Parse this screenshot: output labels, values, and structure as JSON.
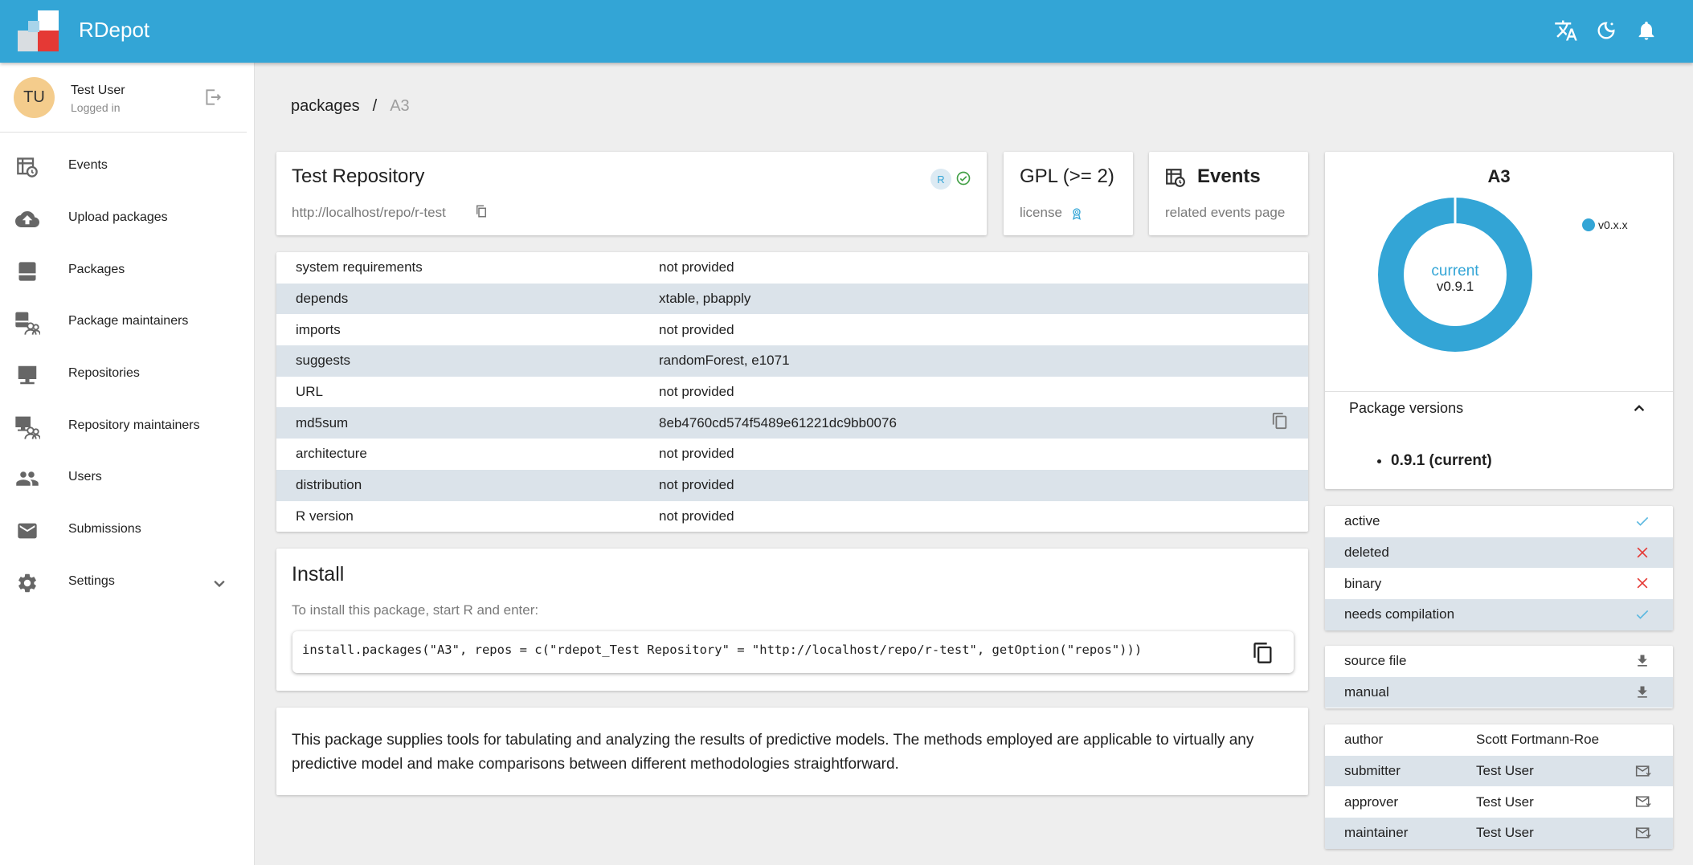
{
  "app": {
    "title": "RDepot"
  },
  "user": {
    "initials": "TU",
    "name": "Test User",
    "status": "Logged in"
  },
  "nav": [
    {
      "label": "Events",
      "icon": "events-icon"
    },
    {
      "label": "Upload packages",
      "icon": "cloud-upload-icon"
    },
    {
      "label": "Packages",
      "icon": "package-icon"
    },
    {
      "label": "Package maintainers",
      "icon": "package-maintainers-icon"
    },
    {
      "label": "Repositories",
      "icon": "repository-icon"
    },
    {
      "label": "Repository maintainers",
      "icon": "repository-maintainers-icon"
    },
    {
      "label": "Users",
      "icon": "users-icon"
    },
    {
      "label": "Submissions",
      "icon": "mail-icon"
    },
    {
      "label": "Settings",
      "icon": "gear-icon"
    }
  ],
  "breadcrumb": {
    "root": "packages",
    "sep": "/",
    "current": "A3"
  },
  "repo_card": {
    "title": "Test Repository",
    "url": "http://localhost/repo/r-test",
    "badge": "R"
  },
  "license_card": {
    "title": "GPL (>= 2)",
    "sub": "license"
  },
  "events_card": {
    "title": "Events",
    "sub": "related events page"
  },
  "properties": [
    {
      "key": "system requirements",
      "value": "not  provided"
    },
    {
      "key": "depends",
      "value": "xtable,  pbapply"
    },
    {
      "key": "imports",
      "value": "not  provided"
    },
    {
      "key": "suggests",
      "value": "randomForest,  e1071"
    },
    {
      "key": "URL",
      "value": "not  provided"
    },
    {
      "key": "md5sum",
      "value": "8eb4760cd574f5489e61221dc9bb0076"
    },
    {
      "key": "architecture",
      "value": "not  provided"
    },
    {
      "key": "distribution",
      "value": "not  provided"
    },
    {
      "key": "R version",
      "value": "not  provided"
    }
  ],
  "install": {
    "title": "Install",
    "hint": "To install this package, start R and enter:",
    "code": "install.packages(\"A3\", repos = c(\"rdepot_Test Repository\" = \"http://localhost/repo/r-test\", getOption(\"repos\")))"
  },
  "description": "This package supplies tools for tabulating and analyzing the results of predictive models. The methods employed are applicable to virtually any predictive model and make comparisons between different methodologies straightforward.",
  "versions_card": {
    "title": "A3",
    "center_label": "current",
    "center_value": "v0.9.1",
    "legend": "v0.x.x",
    "versions_title": "Package versions",
    "versions": [
      "0.9.1 (current)"
    ]
  },
  "chart_data": {
    "type": "pie",
    "title": "A3",
    "categories": [
      "v0.x.x"
    ],
    "values": [
      1
    ],
    "colors": [
      "#33a5d6"
    ]
  },
  "flags": [
    {
      "label": "active",
      "value": true
    },
    {
      "label": "deleted",
      "value": false
    },
    {
      "label": "binary",
      "value": false
    },
    {
      "label": "needs compilation",
      "value": true
    }
  ],
  "files": [
    {
      "label": "source file"
    },
    {
      "label": "manual"
    }
  ],
  "people": [
    {
      "role": "author",
      "name": "Scott  Fortmann-Roe",
      "mail": false
    },
    {
      "role": "submitter",
      "name": "Test User",
      "mail": true
    },
    {
      "role": "approver",
      "name": "Test User",
      "mail": true
    },
    {
      "role": "maintainer",
      "name": "Test User",
      "mail": true
    }
  ],
  "colors": {
    "primary": "#33a5d6",
    "stripe": "#dbe3ea",
    "check": "#5bb8e0",
    "cross": "#e53935"
  }
}
